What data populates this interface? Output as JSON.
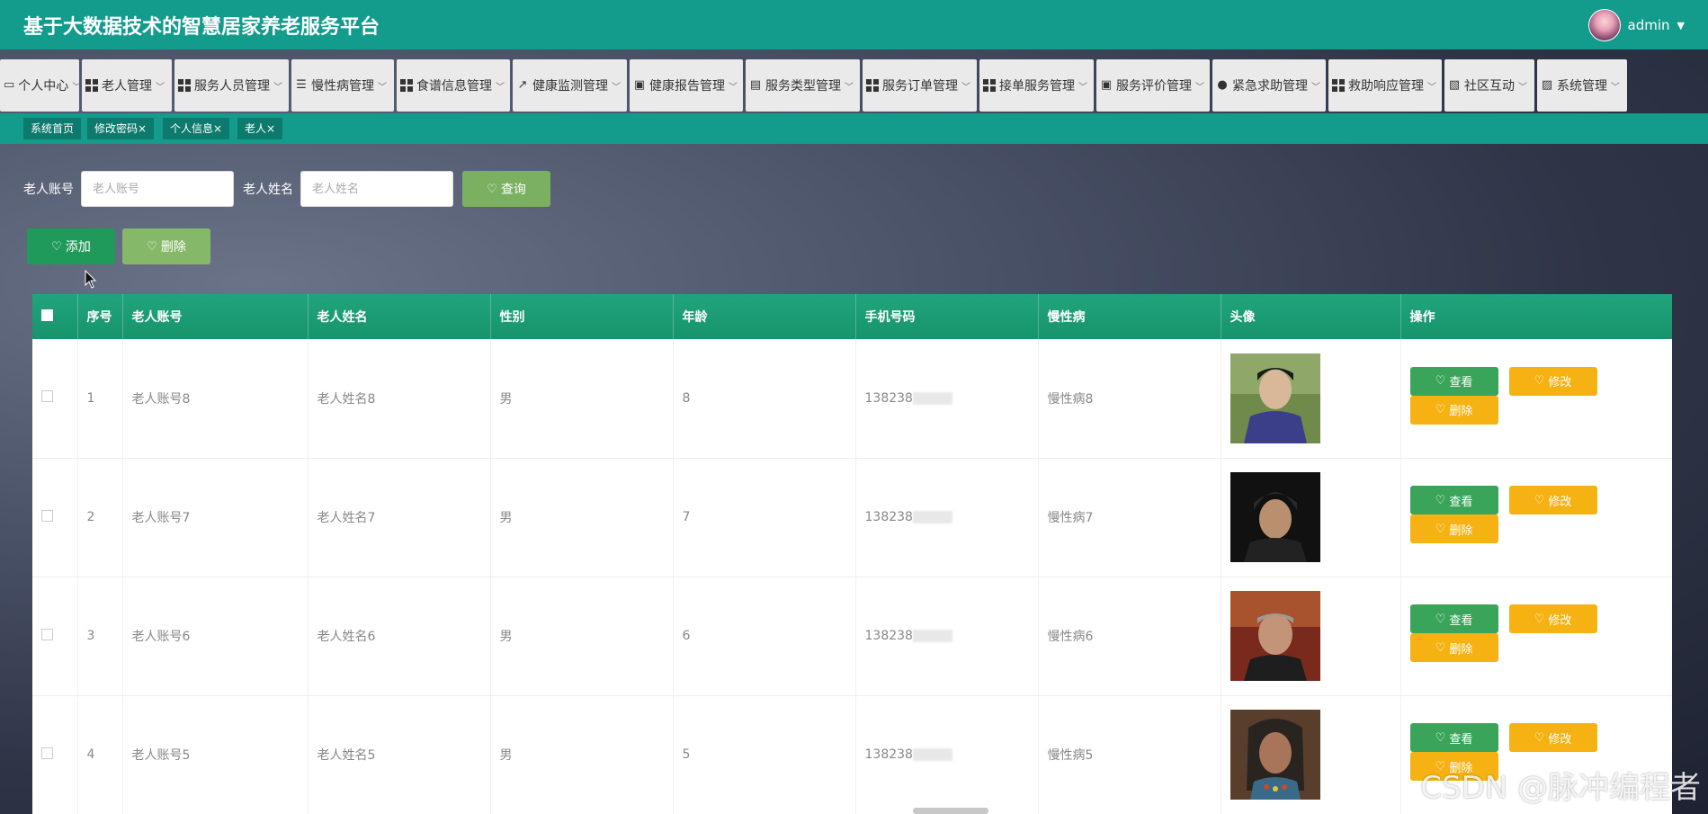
{
  "header": {
    "title": "基于大数据技术的智慧居家养老服务平台",
    "username": "admin"
  },
  "nav": [
    {
      "label": "个人中心",
      "icon": "user-card-icon"
    },
    {
      "label": "老人管理",
      "icon": "grid-icon"
    },
    {
      "label": "服务人员管理",
      "icon": "grid-icon"
    },
    {
      "label": "慢性病管理",
      "icon": "sliders-icon"
    },
    {
      "label": "食谱信息管理",
      "icon": "grid-icon"
    },
    {
      "label": "健康监测管理",
      "icon": "chart-icon"
    },
    {
      "label": "健康报告管理",
      "icon": "briefcase-icon"
    },
    {
      "label": "服务类型管理",
      "icon": "clipboard-icon"
    },
    {
      "label": "服务订单管理",
      "icon": "grid-icon"
    },
    {
      "label": "接单服务管理",
      "icon": "grid-icon"
    },
    {
      "label": "服务评价管理",
      "icon": "briefcase-icon"
    },
    {
      "label": "紧急求助管理",
      "icon": "person-icon"
    },
    {
      "label": "救助响应管理",
      "icon": "grid-icon"
    },
    {
      "label": "社区互动",
      "icon": "clipboard-x-icon"
    },
    {
      "label": "系统管理",
      "icon": "clipboard-check-icon"
    }
  ],
  "tabs": [
    {
      "label": "系统首页"
    },
    {
      "label": "修改密码×"
    },
    {
      "label": "个人信息×"
    },
    {
      "label": "老人×"
    }
  ],
  "search": {
    "account_label": "老人账号",
    "account_placeholder": "老人账号",
    "name_label": "老人姓名",
    "name_placeholder": "老人姓名",
    "query_button": "查询"
  },
  "actions": {
    "add_button": "添加",
    "delete_button": "删除"
  },
  "table": {
    "columns": [
      "序号",
      "老人账号",
      "老人姓名",
      "性别",
      "年龄",
      "手机号码",
      "慢性病",
      "头像",
      "操作"
    ],
    "rows": [
      {
        "index": "1",
        "account": "老人账号8",
        "name": "老人姓名8",
        "gender": "男",
        "age": "8",
        "phone": "138238",
        "disease": "慢性病8"
      },
      {
        "index": "2",
        "account": "老人账号7",
        "name": "老人姓名7",
        "gender": "男",
        "age": "7",
        "phone": "138238",
        "disease": "慢性病7"
      },
      {
        "index": "3",
        "account": "老人账号6",
        "name": "老人姓名6",
        "gender": "男",
        "age": "6",
        "phone": "138238",
        "disease": "慢性病6"
      },
      {
        "index": "4",
        "account": "老人账号5",
        "name": "老人姓名5",
        "gender": "男",
        "age": "5",
        "phone": "138238",
        "disease": "慢性病5"
      }
    ],
    "row_buttons": {
      "view": "查看",
      "edit": "修改",
      "remove": "删除"
    }
  },
  "watermark": "CSDN @脉冲编程者",
  "colors": {
    "header": "#139b8c",
    "tabbar": "#139b8c",
    "tab": "#0e7a6d",
    "add": "#1f9a5a",
    "query": "#7ab060",
    "view": "#3aa55a",
    "edit": "#f5b212"
  }
}
